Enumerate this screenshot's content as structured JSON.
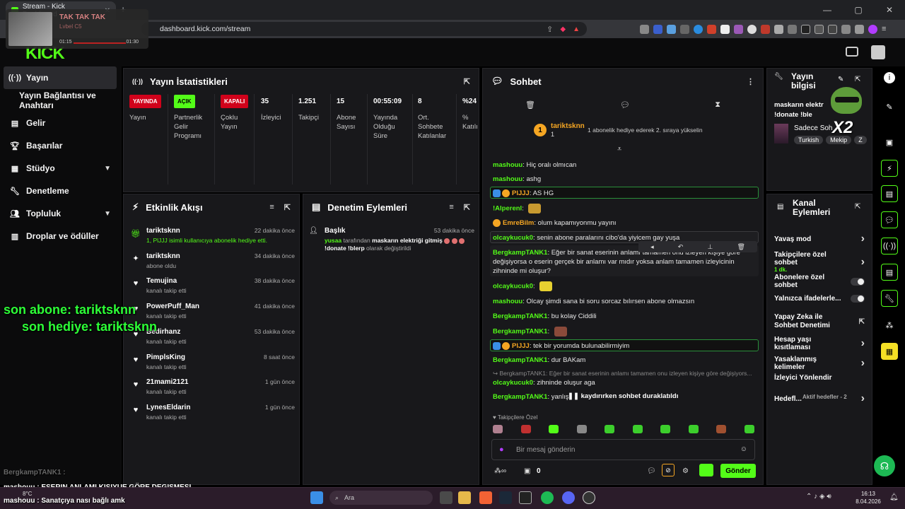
{
  "browser": {
    "tab_title": "Stream - Kick Dashboard",
    "url": "dashboard.kick.com/stream",
    "new_tab": "+",
    "win_min": "—",
    "win_max": "▢",
    "win_close": "✕"
  },
  "music": {
    "title": "TAK TAK TAK",
    "artist": "Lvbel C5",
    "time_current": "01:15",
    "time_total": "01:30"
  },
  "kick": {
    "logo": "KICK"
  },
  "sidebar": {
    "items": [
      {
        "label": "Yayın",
        "icon": "broadcast-icon"
      },
      {
        "label": "Yayın Bağlantısı ve Anahtarı"
      },
      {
        "label": "Gelir",
        "icon": "revenue-icon"
      },
      {
        "label": "Başarılar",
        "icon": "trophy-icon"
      },
      {
        "label": "Stüdyo",
        "icon": "studio-icon"
      },
      {
        "label": "Denetleme",
        "icon": "wrench-icon"
      },
      {
        "label": "Topluluk",
        "icon": "community-icon"
      },
      {
        "label": "Droplar ve ödüller",
        "icon": "drops-icon"
      }
    ]
  },
  "stats": {
    "title": "Yayın İstatistikleri",
    "items": [
      {
        "value": "YAYINDA",
        "label": "Yayın",
        "badge_color": "#d0021b"
      },
      {
        "value": "AÇIK",
        "label": "Partnerlik Gelir Programı",
        "badge_color": "#53fc18"
      },
      {
        "value": "KAPALI",
        "label": "Çoklu Yayın",
        "badge_color": "#d0021b"
      },
      {
        "value": "35",
        "label": "İzleyici"
      },
      {
        "value": "1.251",
        "label": "Takipçi"
      },
      {
        "value": "15",
        "label": "Abone Sayısı"
      },
      {
        "value": "00:55:09",
        "label": "Yayında Olduğu Süre"
      },
      {
        "value": "8",
        "label": "Ort. Sohbete Katılanlar"
      },
      {
        "value": "%24",
        "label": "% Katılı"
      }
    ]
  },
  "events": {
    "title": "Etkinlik Akışı",
    "items": [
      {
        "name": "tariktsknn",
        "sub": "1, PlJJJ isimli kullanıcıya abonelik hediye etti.",
        "time": "22 dakika önce",
        "icon": "gift-icon"
      },
      {
        "name": "tariktsknn",
        "sub": "abone oldu",
        "time": "34 dakika önce",
        "icon": "star-icon"
      },
      {
        "name": "Temujina",
        "sub": "kanalı takip etti",
        "time": "38 dakika önce",
        "icon": "heart-icon"
      },
      {
        "name": "PowerPuff_Man",
        "sub": "kanalı takip etti",
        "time": "41 dakika önce",
        "icon": "heart-icon"
      },
      {
        "name": "Bedirhanz",
        "sub": "kanalı takip etti",
        "time": "53 dakika önce",
        "icon": "heart-icon"
      },
      {
        "name": "PimplsKing",
        "sub": "kanalı takip etti",
        "time": "8 saat önce",
        "icon": "heart-icon"
      },
      {
        "name": "21mami2121",
        "sub": "kanalı takip etti",
        "time": "1 gün önce",
        "icon": "heart-icon"
      },
      {
        "name": "LynesEldarin",
        "sub": "kanalı takip etti",
        "time": "1 gün önce",
        "icon": "heart-icon"
      }
    ]
  },
  "moderation": {
    "title": "Denetim Eylemleri",
    "item": {
      "heading": "Başlık",
      "time": "53 dakika önce",
      "user": "yusaa",
      "text1": "tarafından",
      "title_value": "maskarın elektriği gitmiş",
      "text2": "!donate !blerp",
      "text3": "olarak değiştirildi"
    }
  },
  "chat": {
    "title": "Sohbet",
    "pinned_user": "tariktsknn",
    "pinned_count": "1",
    "pinned_rank": "1",
    "pinned_text": "1 abonelik hediye ederek 2. sıraya yükselin",
    "messages": [
      {
        "user": "mashouu",
        "text": "Hiç oralı olmıcan"
      },
      {
        "user": "mashouu",
        "text": "ashg"
      },
      {
        "user": "PlJJJ",
        "text": "AS HG",
        "mod": true
      },
      {
        "user": "!Alperenl",
        "text": ""
      },
      {
        "user": "EmreBilm",
        "text": "olum kapamıyonmu yayını"
      },
      {
        "user": "olcaykucuk0",
        "text": "senin abone paralarını cibo'da yiyicem gay yuşa"
      },
      {
        "user": "BergkampTANK1",
        "text": "Eğer bir sanat eserinin anlamı tamamen onu izleyen kişiye göre değişiyorsa o eserin gerçek bir anlamı var mıdır yoksa anlam tamamen izleyicinin zihninde mi oluşur?"
      },
      {
        "user": "olcaykucuk0",
        "text": ""
      },
      {
        "user": "mashouu",
        "text": "Olcay şimdi sana bi soru sorcaz bılırsen abone olmazsın"
      },
      {
        "user": "BergkampTANK1",
        "text": "bu kolay Ciddili"
      },
      {
        "user": "BergkampTANK1",
        "text": ""
      },
      {
        "user": "PlJJJ",
        "text": "tek bir yorumda bulunabilirmiyim",
        "mod": true
      },
      {
        "user": "BergkampTANK1",
        "text": "dur BAKam"
      },
      {
        "reply": "BergkampTANK1: Eğer bir sanat eserinin anlamı tamamen onu izleyen kişiye göre değişiyors..."
      },
      {
        "user": "olcaykucuk0",
        "text": "zihninde oluşur aga"
      },
      {
        "user": "BergkampTANK1",
        "text": "yanlış"
      }
    ],
    "paused": "kaydırırken sohbet duraklatıldı",
    "followers_only": "Takipçilere Özel",
    "input_placeholder": "Bir mesaj gönderin",
    "count_zero": "0",
    "send_label": "Gönder"
  },
  "stream_info": {
    "title": "Yayın bilgisi",
    "stream_title": "maskarın elektr",
    "stream_title2": "!donate !ble",
    "category": "Sadece Soh",
    "tags": [
      "Turkish",
      "Mekip",
      "Z"
    ]
  },
  "channel_actions": {
    "title": "Kanal Eylemleri",
    "items": [
      {
        "label": "Yavaş mod",
        "type": "chevron"
      },
      {
        "label": "Takipçilere özel sohbet",
        "sub": "1 dk.",
        "type": "chevron"
      },
      {
        "label": "Abonelere özel sohbet",
        "type": "toggle"
      },
      {
        "label": "Yalnızca ifadelerle...",
        "type": "toggle"
      },
      {
        "label": "Yapay Zeka ile Sohbet Denetimi",
        "type": "external"
      },
      {
        "label": "Hesap yaşı kısıtlaması",
        "type": "chevron"
      },
      {
        "label": "Yasaklanmış kelimeler",
        "type": "chevron"
      },
      {
        "label": "İzleyici Yönlendir",
        "type": "none"
      },
      {
        "label": "Hedefl...",
        "sub": "Aktif hedefler - 2",
        "type": "chevron"
      }
    ]
  },
  "overlay": {
    "last_sub": "son abone: tariktsknn",
    "last_gift": "son hediye: tariktsknn",
    "x2": "X2",
    "chat_lines": [
      {
        "user": "BergkampTANK1",
        "text": ""
      },
      {
        "user": "mashouu",
        "text": "ESERIN ANLAMI KISIYUE GÖRE DEGISMESI"
      },
      {
        "user": "mashouu",
        "text": "Sanatçıya nası bağlı amk"
      }
    ]
  },
  "taskbar": {
    "weather": "8°C",
    "search": "Ara",
    "time": "16:13",
    "date": "8.04.2026"
  }
}
